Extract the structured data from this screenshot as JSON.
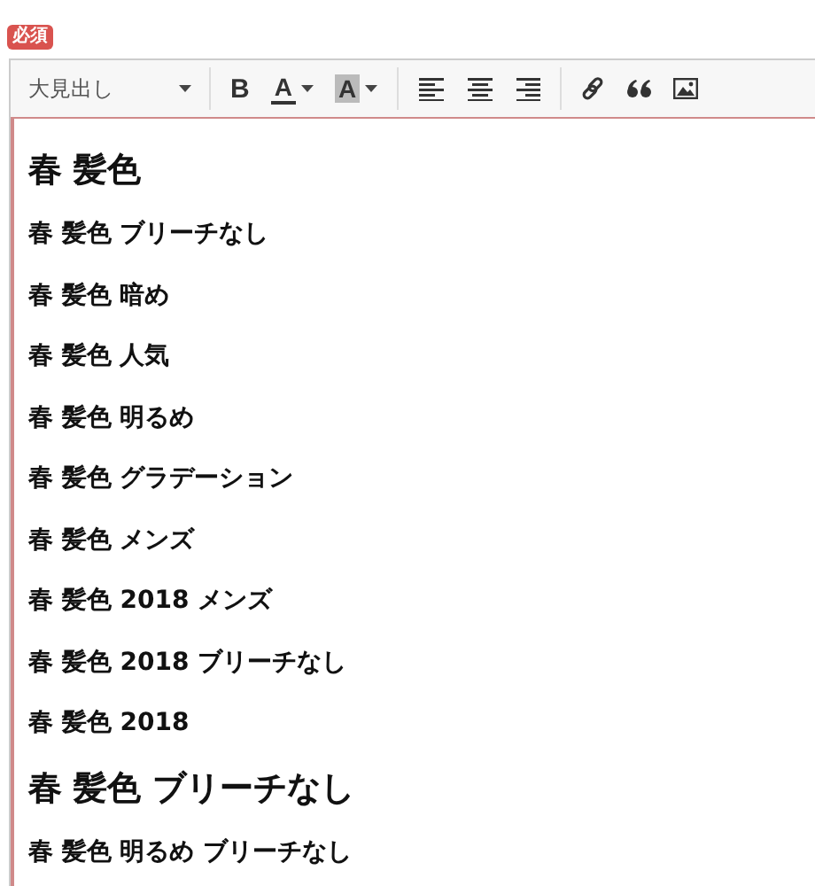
{
  "badge": "必須",
  "toolbar": {
    "groups": [
      [
        {
          "kind": "format",
          "label": "大見出し"
        }
      ],
      [
        {
          "kind": "bold",
          "label": "B"
        },
        {
          "kind": "font-color",
          "label": "A"
        },
        {
          "kind": "highlight",
          "label": "A"
        }
      ],
      [
        {
          "kind": "align-left"
        },
        {
          "kind": "align-center"
        },
        {
          "kind": "align-right"
        }
      ],
      [
        {
          "kind": "link"
        },
        {
          "kind": "quote"
        },
        {
          "kind": "image"
        }
      ]
    ]
  },
  "content": [
    {
      "kind": "large",
      "text": "春 髪色"
    },
    {
      "kind": "small",
      "text": "春 髪色 ブリーチなし"
    },
    {
      "kind": "small",
      "text": "春 髪色 暗め"
    },
    {
      "kind": "small",
      "text": "春 髪色 人気"
    },
    {
      "kind": "small",
      "text": "春 髪色 明るめ"
    },
    {
      "kind": "small",
      "text": "春 髪色 グラデーション"
    },
    {
      "kind": "small",
      "text": "春 髪色 メンズ"
    },
    {
      "kind": "small",
      "text": "春 髪色 2018 メンズ"
    },
    {
      "kind": "small",
      "text": "春 髪色 2018 ブリーチなし"
    },
    {
      "kind": "small",
      "text": "春 髪色 2018"
    },
    {
      "kind": "large",
      "text": "春 髪色 ブリーチなし"
    },
    {
      "kind": "small",
      "text": "春 髪色 明るめ ブリーチなし"
    }
  ]
}
